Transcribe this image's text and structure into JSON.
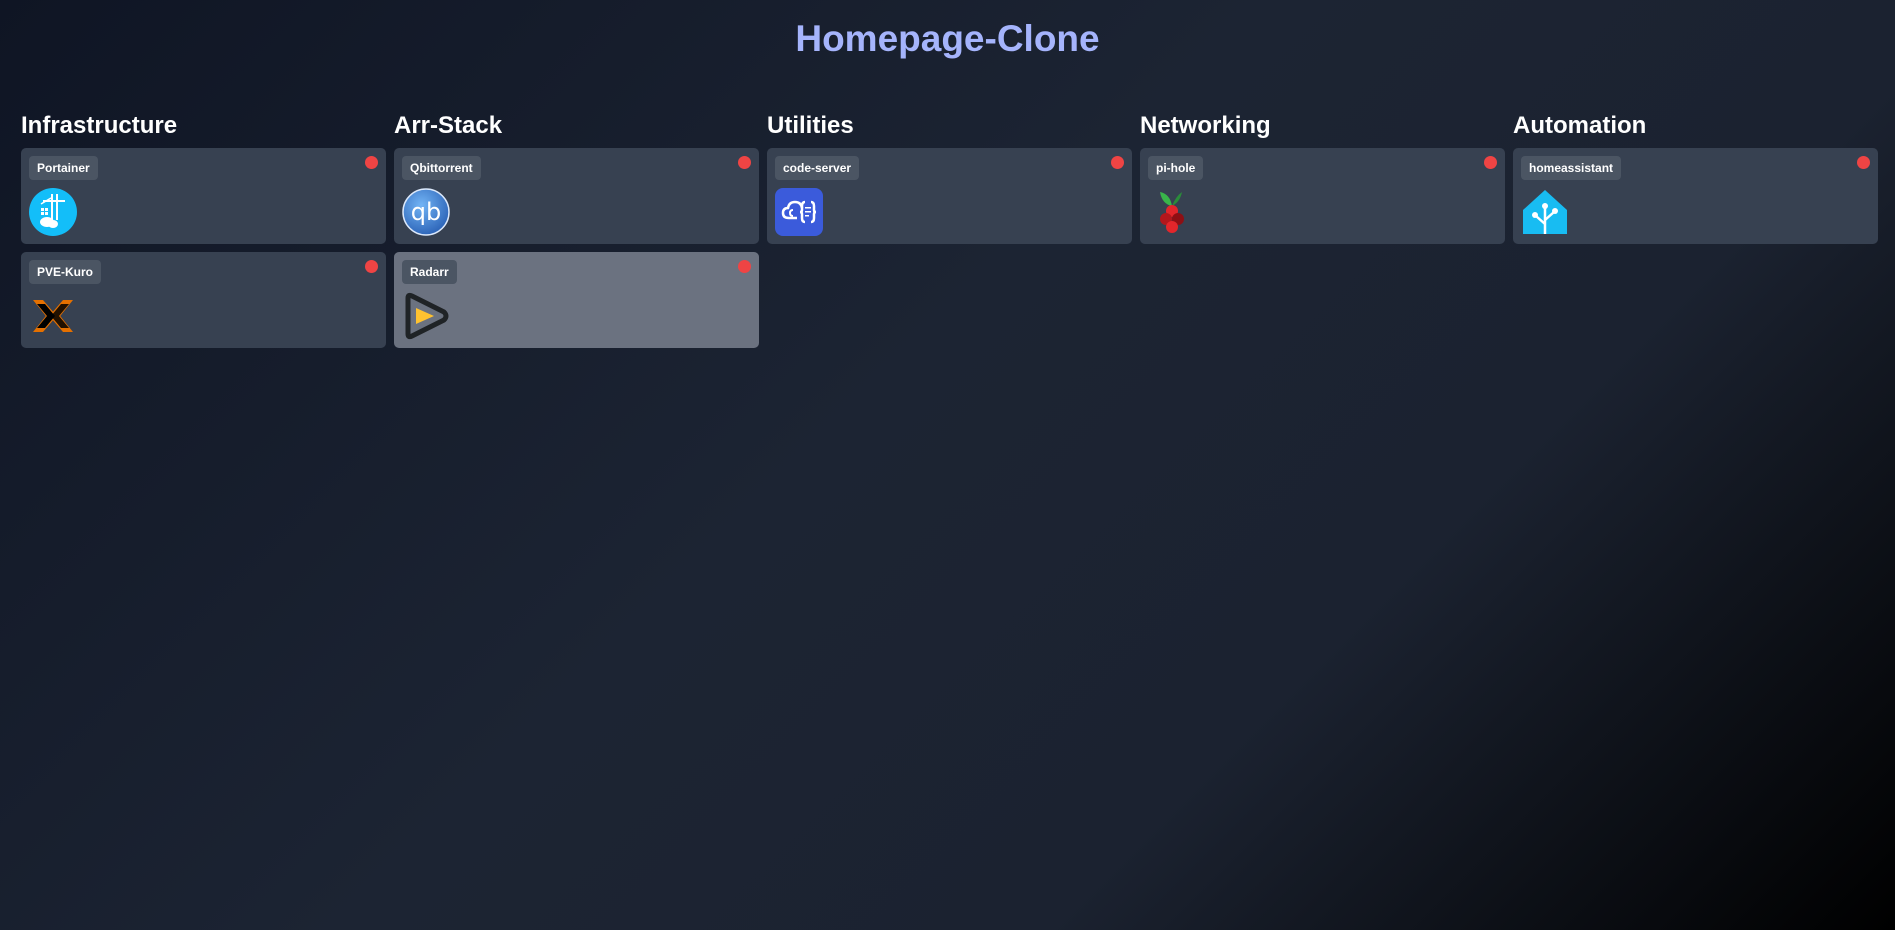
{
  "title": "Homepage-Clone",
  "status_color": "#ef4444",
  "groups": [
    {
      "name": "Infrastructure",
      "services": [
        {
          "label": "Portainer",
          "icon": "portainer-icon",
          "status": "offline"
        },
        {
          "label": "PVE-Kuro",
          "icon": "proxmox-icon",
          "status": "offline"
        }
      ]
    },
    {
      "name": "Arr-Stack",
      "services": [
        {
          "label": "Qbittorrent",
          "icon": "qbittorrent-icon",
          "status": "offline"
        },
        {
          "label": "Radarr",
          "icon": "radarr-icon",
          "status": "offline"
        }
      ]
    },
    {
      "name": "Utilities",
      "services": [
        {
          "label": "code-server",
          "icon": "code-server-icon",
          "status": "offline"
        }
      ]
    },
    {
      "name": "Networking",
      "services": [
        {
          "label": "pi-hole",
          "icon": "pihole-icon",
          "status": "offline"
        }
      ]
    },
    {
      "name": "Automation",
      "services": [
        {
          "label": "homeassistant",
          "icon": "home-assistant-icon",
          "status": "offline"
        }
      ]
    }
  ]
}
